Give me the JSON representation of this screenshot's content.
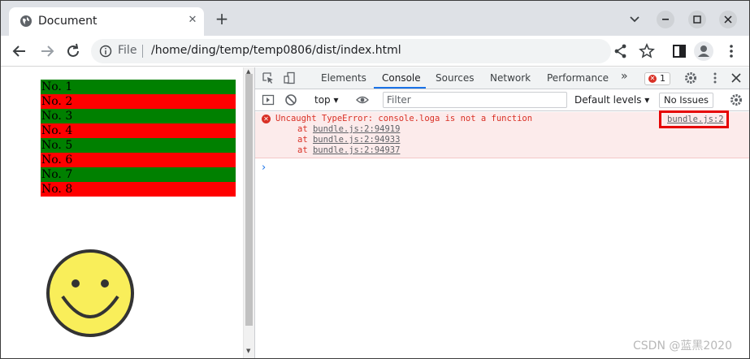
{
  "browser": {
    "tab_title": "Document",
    "close_tab_glyph": "✕",
    "new_tab_glyph": "+",
    "omnibox_scheme_label": "File",
    "url": "/home/ding/temp/temp0806/dist/index.html"
  },
  "page": {
    "rows": [
      {
        "label": "No. 1",
        "color": "#008000"
      },
      {
        "label": "No. 2",
        "color": "#ff0000"
      },
      {
        "label": "No. 3",
        "color": "#008000"
      },
      {
        "label": "No. 4",
        "color": "#ff0000"
      },
      {
        "label": "No. 5",
        "color": "#008000"
      },
      {
        "label": "No. 6",
        "color": "#ff0000"
      },
      {
        "label": "No. 7",
        "color": "#008000"
      },
      {
        "label": "No. 8",
        "color": "#ff0000"
      }
    ]
  },
  "devtools": {
    "tabs": [
      "Elements",
      "Console",
      "Sources",
      "Network",
      "Performance"
    ],
    "more_tabs_glyph": "»",
    "error_count": "1",
    "context_select": "top",
    "filter_placeholder": "Filter",
    "levels_label": "Default levels",
    "issues_label": "No Issues",
    "error": {
      "message": "Uncaught TypeError: console.loga is not a function",
      "source_link": "bundle.js:2",
      "stack": [
        {
          "prefix": "at ",
          "link": "bundle.js:2:94919"
        },
        {
          "prefix": "at ",
          "link": "bundle.js:2:94933"
        },
        {
          "prefix": "at ",
          "link": "bundle.js:2:94937"
        }
      ]
    },
    "prompt_glyph": "›"
  },
  "colors": {
    "error_red": "#d93025",
    "error_bg": "#fcebeb",
    "highlight_box": "#e60000",
    "active_tab_underline": "#1a73e8",
    "smiley_face": "#f9ee5a"
  },
  "watermark": "CSDN @蓝黑2020"
}
